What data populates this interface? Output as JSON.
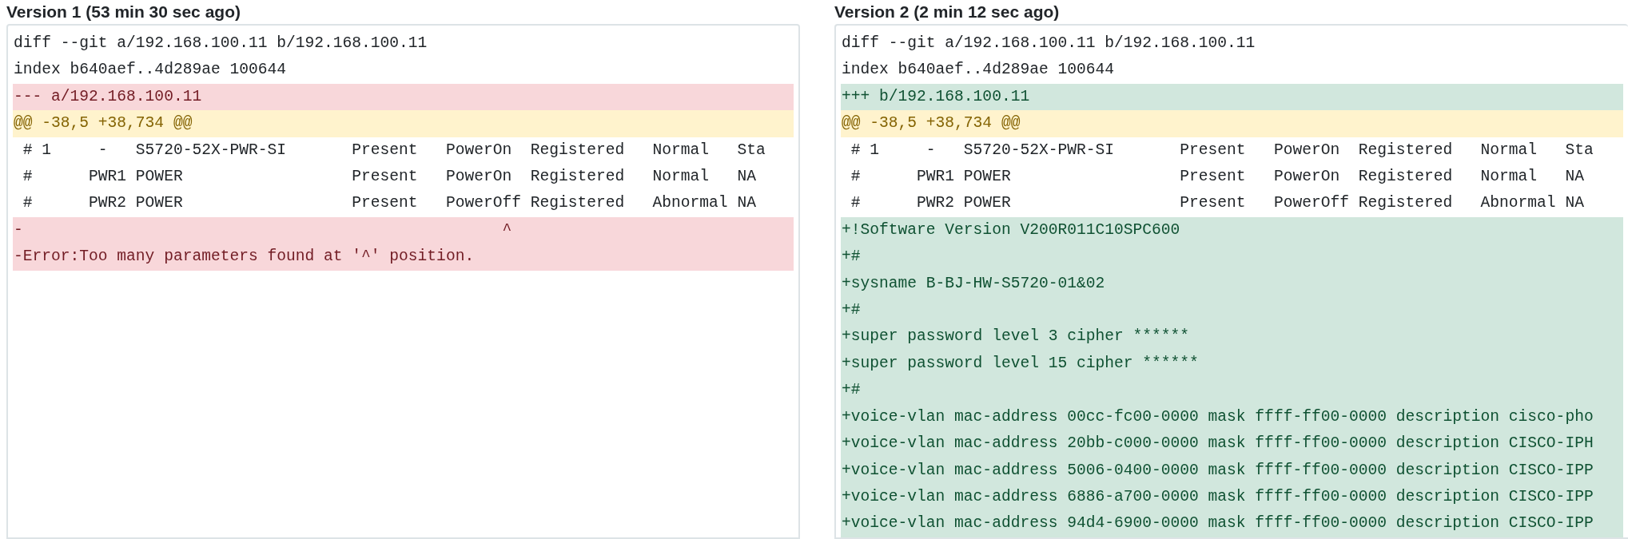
{
  "panels": [
    {
      "title": "Version 1 (53 min 30 sec ago)",
      "lines": [
        {
          "kind": "context",
          "text": "diff --git a/192.168.100.11 b/192.168.100.11"
        },
        {
          "kind": "context",
          "text": "index b640aef..4d289ae 100644"
        },
        {
          "kind": "removed",
          "text": "--- a/192.168.100.11"
        },
        {
          "kind": "hunk",
          "text": "@@ -38,5 +38,734 @@"
        },
        {
          "kind": "context",
          "text": " # 1     -   S5720-52X-PWR-SI       Present   PowerOn  Registered   Normal   Sta"
        },
        {
          "kind": "context",
          "text": " #      PWR1 POWER                  Present   PowerOn  Registered   Normal   NA"
        },
        {
          "kind": "context",
          "text": " #      PWR2 POWER                  Present   PowerOff Registered   Abnormal NA"
        },
        {
          "kind": "removed",
          "text": "-                                                   ^"
        },
        {
          "kind": "removed",
          "text": "-Error:Too many parameters found at '^' position."
        }
      ]
    },
    {
      "title": "Version 2 (2 min 12 sec ago)",
      "lines": [
        {
          "kind": "context",
          "text": "diff --git a/192.168.100.11 b/192.168.100.11"
        },
        {
          "kind": "context",
          "text": "index b640aef..4d289ae 100644"
        },
        {
          "kind": "added",
          "text": "+++ b/192.168.100.11"
        },
        {
          "kind": "hunk",
          "text": "@@ -38,5 +38,734 @@"
        },
        {
          "kind": "context",
          "text": " # 1     -   S5720-52X-PWR-SI       Present   PowerOn  Registered   Normal   Sta"
        },
        {
          "kind": "context",
          "text": " #      PWR1 POWER                  Present   PowerOn  Registered   Normal   NA"
        },
        {
          "kind": "context",
          "text": " #      PWR2 POWER                  Present   PowerOff Registered   Abnormal NA"
        },
        {
          "kind": "added",
          "text": "+!Software Version V200R011C10SPC600"
        },
        {
          "kind": "added",
          "text": "+#"
        },
        {
          "kind": "added",
          "text": "+sysname B-BJ-HW-S5720-01&02"
        },
        {
          "kind": "added",
          "text": "+#"
        },
        {
          "kind": "added",
          "text": "+super password level 3 cipher ******"
        },
        {
          "kind": "added",
          "text": "+super password level 15 cipher ******"
        },
        {
          "kind": "added",
          "text": "+#"
        },
        {
          "kind": "added",
          "text": "+voice-vlan mac-address 00cc-fc00-0000 mask ffff-ff00-0000 description cisco-pho"
        },
        {
          "kind": "added",
          "text": "+voice-vlan mac-address 20bb-c000-0000 mask ffff-ff00-0000 description CISCO-IPH"
        },
        {
          "kind": "added",
          "text": "+voice-vlan mac-address 5006-0400-0000 mask ffff-ff00-0000 description CISCO-IPP"
        },
        {
          "kind": "added",
          "text": "+voice-vlan mac-address 6886-a700-0000 mask ffff-ff00-0000 description CISCO-IPP"
        },
        {
          "kind": "added",
          "text": "+voice-vlan mac-address 94d4-6900-0000 mask ffff-ff00-0000 description CISCO-IPP"
        }
      ]
    }
  ]
}
